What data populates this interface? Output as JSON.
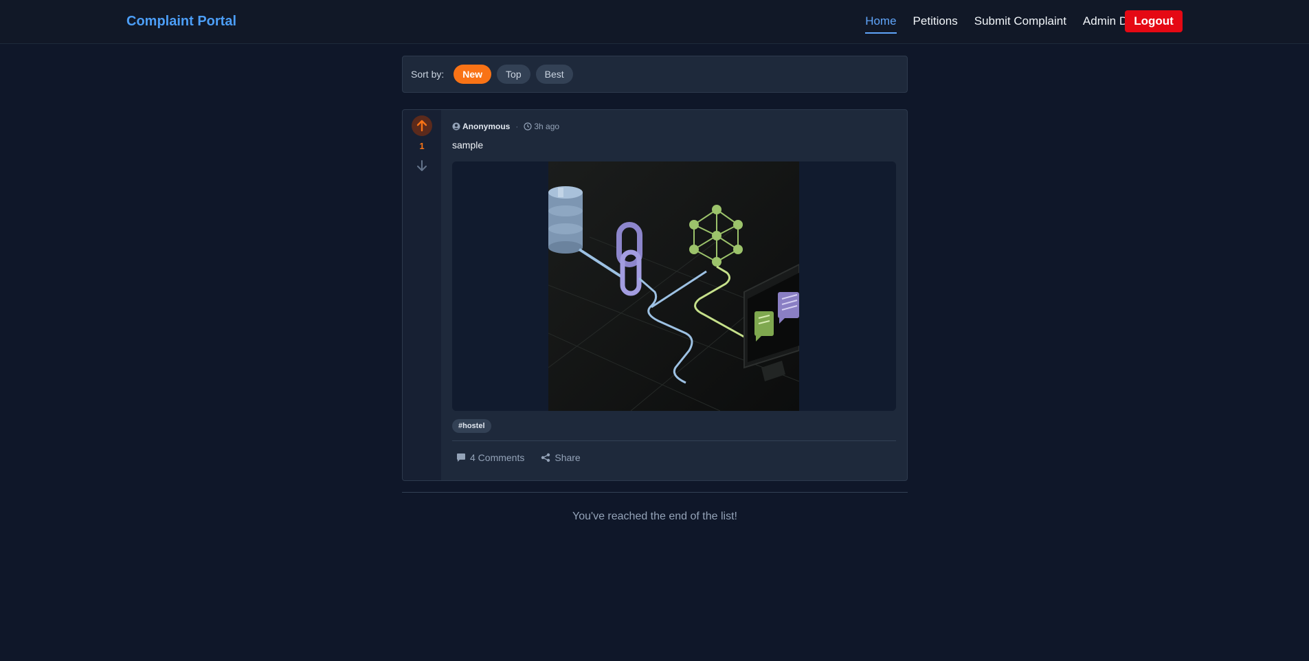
{
  "navbar": {
    "brand": "Complaint Portal",
    "links": [
      {
        "label": "Home",
        "active": true
      },
      {
        "label": "Petitions",
        "active": false
      },
      {
        "label": "Submit Complaint",
        "active": false
      },
      {
        "label": "Admin Dashboard",
        "active": false
      }
    ],
    "logout_label": "Logout"
  },
  "sort": {
    "label": "Sort by:",
    "options": [
      {
        "label": "New",
        "active": true
      },
      {
        "label": "Top",
        "active": false
      },
      {
        "label": "Best",
        "active": false
      }
    ]
  },
  "posts": [
    {
      "votes": "1",
      "upvoted": true,
      "author": "Anonymous",
      "time": "3h ago",
      "title": "sample",
      "image_icon": "tech-network-illustration",
      "tags": [
        "#hostel"
      ],
      "comments_label": "4 Comments",
      "share_label": "Share"
    }
  ],
  "footer": {
    "end_message": "You've reached the end of the list!"
  },
  "colors": {
    "accent": "#f97316",
    "brand": "#4c9ef7",
    "logout": "#e50914",
    "background": "#0f1729"
  }
}
